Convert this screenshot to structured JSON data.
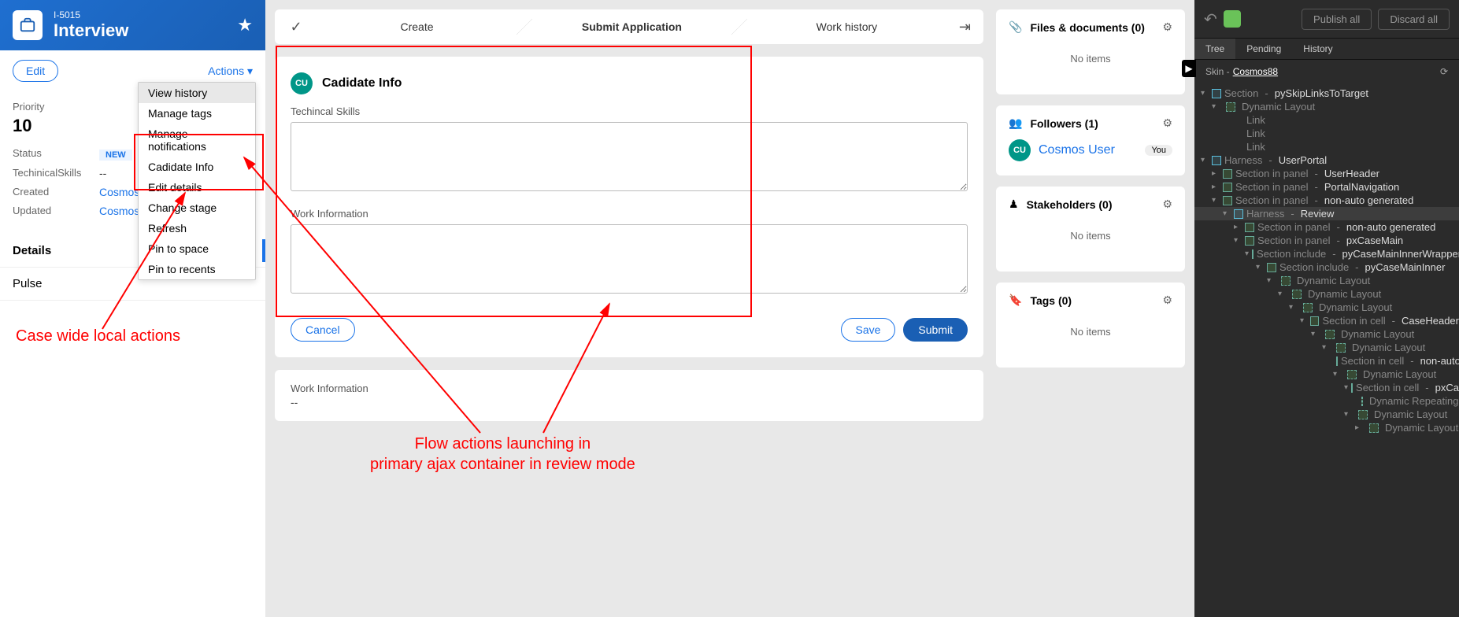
{
  "case": {
    "id": "I-5015",
    "title": "Interview",
    "edit_label": "Edit",
    "actions_label": "Actions"
  },
  "summary": {
    "priority_label": "Priority",
    "priority_value": "10",
    "status_label": "Status",
    "status_value": "NEW",
    "techskills_label": "TechinicalSkills",
    "techskills_value": "--",
    "created_label": "Created",
    "created_value": "Cosmos U",
    "updated_label": "Updated",
    "updated_value": "Cosmos U"
  },
  "tabs": {
    "details": "Details",
    "pulse": "Pulse"
  },
  "actions_menu": [
    "View history",
    "Manage tags",
    "Manage notifications",
    "Cadidate Info",
    "Edit details",
    "Change stage",
    "Refresh",
    "Pin to space",
    "Pin to recents"
  ],
  "stages": {
    "s1": "Create",
    "s2": "Submit Application",
    "s3": "Work history"
  },
  "form": {
    "heading": "Cadidate Info",
    "avatar": "CU",
    "f1_label": "Techincal Skills",
    "f2_label": "Work Information",
    "cancel": "Cancel",
    "save": "Save",
    "submit": "Submit"
  },
  "work_info": {
    "label": "Work Information",
    "value": "--"
  },
  "sidecards": {
    "files": "Files & documents (0)",
    "followers": "Followers (1)",
    "follower_name": "Cosmos User",
    "you": "You",
    "stakeholders": "Stakeholders (0)",
    "tags": "Tags (0)",
    "noitems": "No items"
  },
  "annotations": {
    "a1": "Case wide local actions",
    "a2a": "Flow actions launching in",
    "a2b": "primary ajax container in review mode"
  },
  "dev": {
    "publish": "Publish all",
    "discard": "Discard all",
    "tabs": {
      "tree": "Tree",
      "pending": "Pending",
      "history": "History"
    },
    "skin_prefix": "Skin -",
    "skin_name": "Cosmos88",
    "tree": [
      {
        "d": 0,
        "tw": "▾",
        "ic": "cyan",
        "type": "Section",
        "name": "pySkipLinksToTarget"
      },
      {
        "d": 1,
        "tw": "▾",
        "ic": "dash",
        "type": "Dynamic Layout",
        "name": ""
      },
      {
        "d": 2,
        "tw": "",
        "ic": "",
        "type": "Link",
        "name": ""
      },
      {
        "d": 2,
        "tw": "",
        "ic": "",
        "type": "Link",
        "name": ""
      },
      {
        "d": 2,
        "tw": "",
        "ic": "",
        "type": "Link",
        "name": ""
      },
      {
        "d": 0,
        "tw": "▾",
        "ic": "cyan",
        "type": "Harness",
        "name": "UserPortal"
      },
      {
        "d": 1,
        "tw": "▸",
        "ic": "green",
        "type": "Section in panel",
        "name": "UserHeader"
      },
      {
        "d": 1,
        "tw": "▸",
        "ic": "green",
        "type": "Section in panel",
        "name": "PortalNavigation"
      },
      {
        "d": 1,
        "tw": "▾",
        "ic": "green",
        "type": "Section in panel",
        "name": "non-auto generated"
      },
      {
        "d": 2,
        "tw": "▾",
        "ic": "cyan",
        "type": "Harness",
        "name": "Review",
        "sel": true
      },
      {
        "d": 3,
        "tw": "▸",
        "ic": "green",
        "type": "Section in panel",
        "name": "non-auto generated"
      },
      {
        "d": 3,
        "tw": "▾",
        "ic": "green",
        "type": "Section in panel",
        "name": "pxCaseMain"
      },
      {
        "d": 4,
        "tw": "▾",
        "ic": "green",
        "type": "Section include",
        "name": "pyCaseMainInnerWrapper"
      },
      {
        "d": 5,
        "tw": "▾",
        "ic": "green",
        "type": "Section include",
        "name": "pyCaseMainInner"
      },
      {
        "d": 6,
        "tw": "▾",
        "ic": "dash",
        "type": "Dynamic Layout",
        "name": ""
      },
      {
        "d": 7,
        "tw": "▾",
        "ic": "dash",
        "type": "Dynamic Layout",
        "name": ""
      },
      {
        "d": 8,
        "tw": "▾",
        "ic": "dash",
        "type": "Dynamic Layout",
        "name": ""
      },
      {
        "d": 9,
        "tw": "▾",
        "ic": "green",
        "type": "Section in cell",
        "name": "CaseHeader"
      },
      {
        "d": 10,
        "tw": "▾",
        "ic": "dash",
        "type": "Dynamic Layout",
        "name": ""
      },
      {
        "d": 11,
        "tw": "▾",
        "ic": "dash",
        "type": "Dynamic Layout",
        "name": ""
      },
      {
        "d": 12,
        "tw": "",
        "ic": "green",
        "type": "Section in cell",
        "name": "non-auto generated"
      },
      {
        "d": 12,
        "tw": "▾",
        "ic": "dash",
        "type": "Dynamic Layout",
        "name": ""
      },
      {
        "d": 13,
        "tw": "▾",
        "ic": "green",
        "type": "Section in cell",
        "name": "pxCaseBreadcrumbs"
      },
      {
        "d": 14,
        "tw": "",
        "ic": "dash",
        "type": "Dynamic Repeating Layout",
        "name": ""
      },
      {
        "d": 13,
        "tw": "▾",
        "ic": "dash",
        "type": "Dynamic Layout",
        "name": ""
      },
      {
        "d": 14,
        "tw": "▸",
        "ic": "dash",
        "type": "Dynamic Layout",
        "name": ""
      }
    ]
  }
}
